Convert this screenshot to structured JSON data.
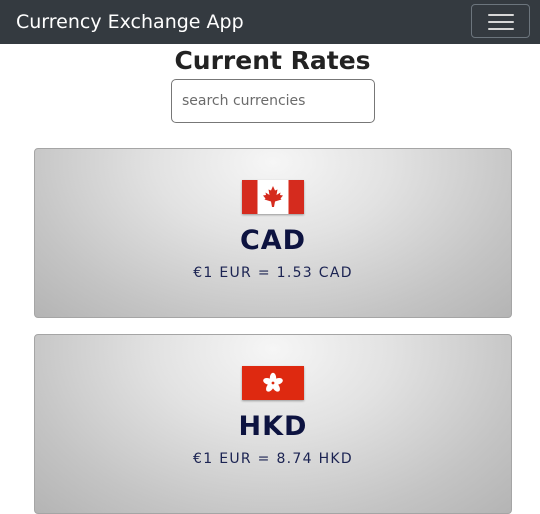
{
  "navbar": {
    "brand": "Currency Exchange App",
    "toggler_icon": "hamburger-menu-icon"
  },
  "page": {
    "title": "Current Rates"
  },
  "search": {
    "placeholder": "search currencies",
    "value": ""
  },
  "currencies": [
    {
      "code": "CAD",
      "rate_text": "€1 EUR = 1.53 CAD",
      "flag_icon": "canada-flag-icon",
      "flag_colors": [
        "#d52b1e",
        "#ffffff"
      ]
    },
    {
      "code": "HKD",
      "rate_text": "€1 EUR = 8.74 HKD",
      "flag_icon": "hong-kong-flag-icon",
      "flag_colors": [
        "#de2910",
        "#ffffff"
      ]
    }
  ],
  "colors": {
    "navbar_bg": "#343a40",
    "code_text": "#0d1340"
  }
}
